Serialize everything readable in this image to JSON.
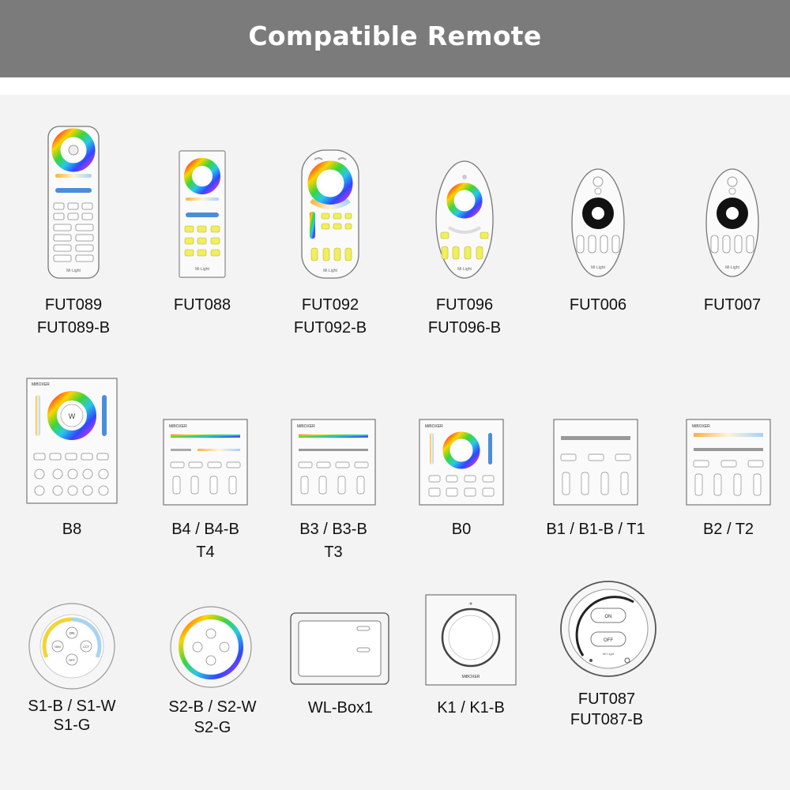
{
  "header": {
    "title": "Compatible Remote"
  },
  "products": [
    {
      "id": "fut089",
      "lines": [
        "FUT089",
        "FUT089-B"
      ],
      "icon": "remote-rgb-icon"
    },
    {
      "id": "fut088",
      "lines": [
        "FUT088"
      ],
      "icon": "remote-rgb-icon"
    },
    {
      "id": "fut092",
      "lines": [
        "FUT092",
        "FUT092-B"
      ],
      "icon": "remote-rgb-icon"
    },
    {
      "id": "fut096",
      "lines": [
        "FUT096",
        "FUT096-B"
      ],
      "icon": "remote-rgb-icon"
    },
    {
      "id": "fut006",
      "lines": [
        "FUT006"
      ],
      "icon": "remote-dimmer-icon"
    },
    {
      "id": "fut007",
      "lines": [
        "FUT007"
      ],
      "icon": "remote-dimmer-icon"
    },
    {
      "id": "b8",
      "lines": [
        "B8"
      ],
      "icon": "wall-panel-icon"
    },
    {
      "id": "b4",
      "lines": [
        "B4 / B4-B",
        "T4"
      ],
      "icon": "wall-panel-icon"
    },
    {
      "id": "b3",
      "lines": [
        "B3 / B3-B",
        "T3"
      ],
      "icon": "wall-panel-icon"
    },
    {
      "id": "b0",
      "lines": [
        "B0"
      ],
      "icon": "wall-panel-icon"
    },
    {
      "id": "b1",
      "lines": [
        "B1 / B1-B / T1"
      ],
      "icon": "wall-panel-icon"
    },
    {
      "id": "b2",
      "lines": [
        "B2 / T2"
      ],
      "icon": "wall-panel-icon"
    },
    {
      "id": "s1",
      "lines": [
        "S1-B / S1-W",
        "S1-G"
      ],
      "icon": "round-remote-icon"
    },
    {
      "id": "s2",
      "lines": [
        "S2-B / S2-W",
        "S2-G"
      ],
      "icon": "round-remote-icon"
    },
    {
      "id": "wlbox1",
      "lines": [
        "WL-Box1"
      ],
      "icon": "wifi-box-icon"
    },
    {
      "id": "k1",
      "lines": [
        "K1 / K1-B"
      ],
      "icon": "knob-panel-icon"
    },
    {
      "id": "fut087",
      "lines": [
        "FUT087",
        "FUT087-B"
      ],
      "icon": "round-remote-icon"
    }
  ],
  "device_text": {
    "on": "ON",
    "off": "OFF",
    "w": "W",
    "brand": "Mi·Light",
    "panel_brand": "MiBOXER",
    "dim": "DIM",
    "cct": "CCT"
  }
}
